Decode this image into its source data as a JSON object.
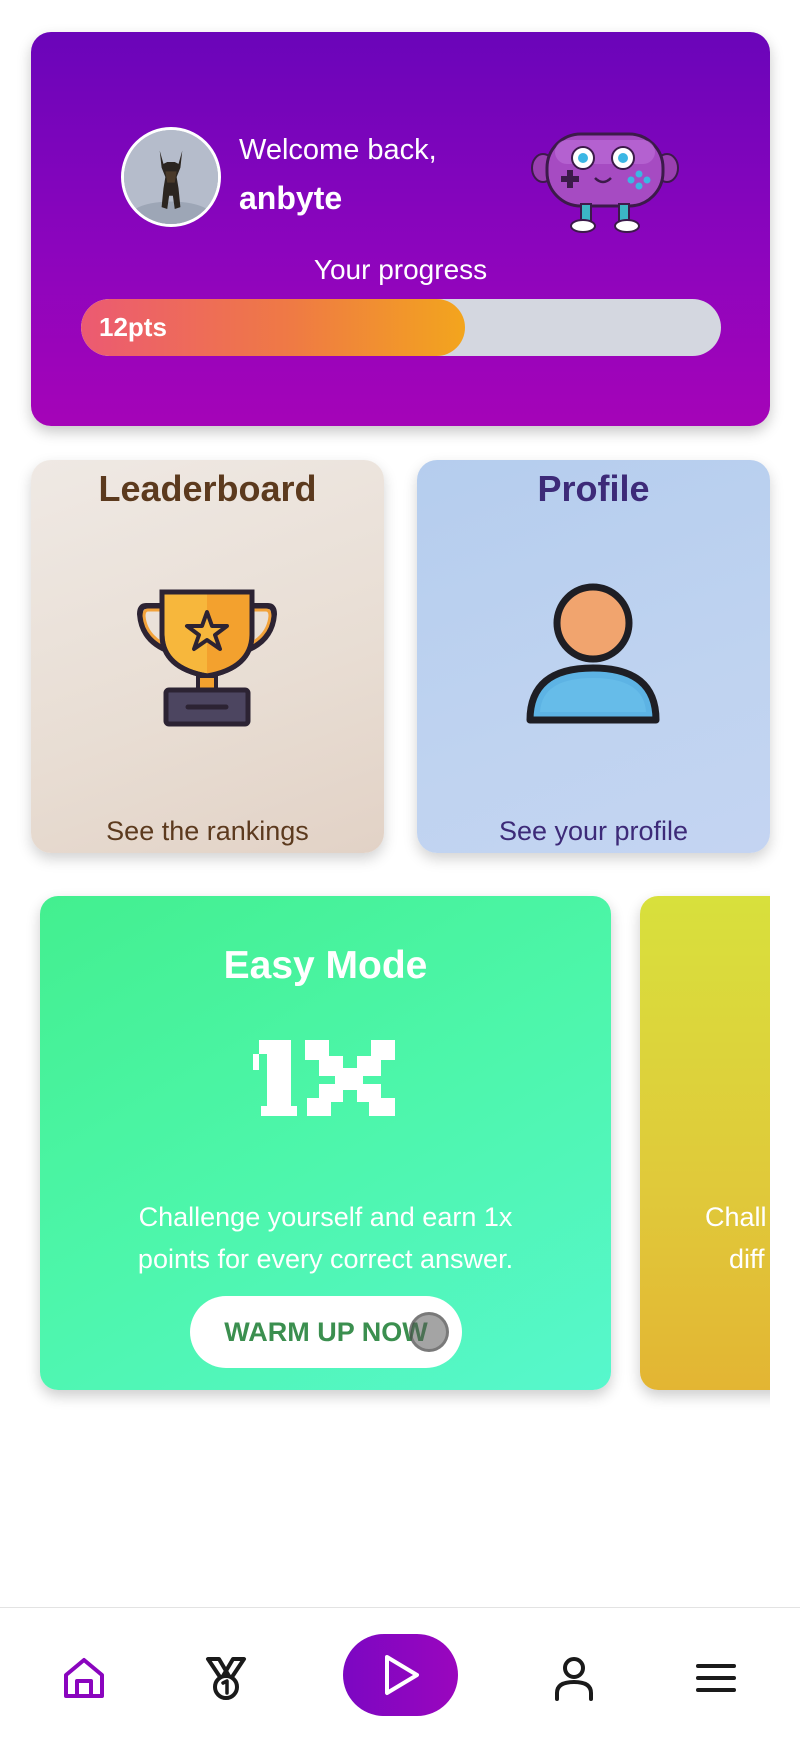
{
  "welcome": {
    "greeting": "Welcome back,",
    "username": "anbyte",
    "progress_label": "Your progress",
    "progress_value": "12pts",
    "progress_fraction": 0.6
  },
  "tiles": {
    "leaderboard": {
      "title": "Leaderboard",
      "subtitle": "See the rankings",
      "icon": "trophy-icon"
    },
    "profile": {
      "title": "Profile",
      "subtitle": "See your profile",
      "icon": "person-icon"
    }
  },
  "modes": [
    {
      "title": "Easy Mode",
      "multiplier": "1X",
      "description_line1": "Challenge yourself and earn 1x",
      "description_line2": "points for every correct answer.",
      "button": "WARM UP NOW"
    },
    {
      "description_line1": "Chall",
      "description_line2": "diff"
    }
  ],
  "nav": {
    "items": [
      "home-icon",
      "medal-icon",
      "play-icon",
      "user-icon",
      "menu-icon"
    ],
    "active_color": "#8a05be"
  },
  "colors": {
    "brand_purple": "#8a05be",
    "easy_green": "#4df6ab",
    "progress_orange": "#ef7a44"
  }
}
